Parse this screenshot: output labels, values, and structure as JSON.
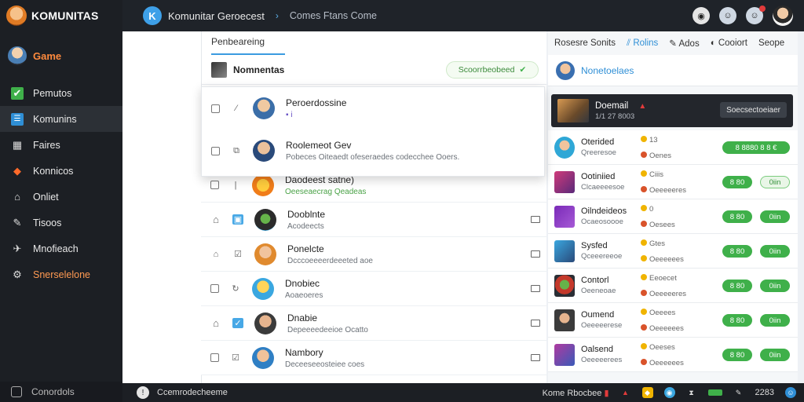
{
  "brand": {
    "name": "KOMUNITAS"
  },
  "sidebar": {
    "game_label": "Game",
    "items": [
      {
        "label": "Pemutos",
        "icon": "check-icon"
      },
      {
        "label": "Komunins",
        "icon": "list-icon"
      },
      {
        "label": "Faires",
        "icon": "grid-icon"
      },
      {
        "label": "Konnicos",
        "icon": "gem-icon"
      },
      {
        "label": "Onliet",
        "icon": "home-icon"
      },
      {
        "label": "Tisoos",
        "icon": "wrench-icon"
      },
      {
        "label": "Mnofieach",
        "icon": "pin-icon"
      },
      {
        "label": "Snerselelone",
        "icon": "gear-icon"
      }
    ],
    "footer": "Conordols"
  },
  "topbar": {
    "title": "Komunitar Geroecest",
    "crumbs": "Comes  Ftans  Come"
  },
  "main": {
    "tab": "Penbeareing",
    "subheader": "Nomnentas",
    "search_pill": "Scoorrbeobeed"
  },
  "dropdown": [
    {
      "title": "Peroerdossine",
      "sub": "▪ i"
    },
    {
      "title": "Roolemeot Gev",
      "sub": "Pobeces Oiteaedt ofeseraedes codecchee Ooers."
    }
  ],
  "list": [
    {
      "title": "Daodeest satne)",
      "sub": "Oeeseaecrag Qeadeas"
    },
    {
      "title": "Dooblnte",
      "sub": "Acodeects"
    },
    {
      "title": "Ponelcte",
      "sub": "Dcccoeeeerdeeeted aoe"
    },
    {
      "title": "Dnobiec",
      "sub": "Aoaeoeres"
    },
    {
      "title": "Dnabie",
      "sub": "Depeeeedeeioe Ocatto"
    },
    {
      "title": "Nambory",
      "sub": "Deceeseeosteiee coes"
    }
  ],
  "right": {
    "head": [
      "Rosesre Sonits",
      "Rolins",
      "Ados",
      "Cooiort",
      "Seope"
    ],
    "title": "Nonetoelaes",
    "featured": {
      "title": "Doemail",
      "sub": "1/1 27  8003",
      "button": "Soecsectoeiaer"
    },
    "rows": [
      {
        "title": "Oterided",
        "sub": "Qreeresoe",
        "stat1": "13",
        "stat2": "Oenes",
        "pill1": "8 8880 8 8 €",
        "pill2": ""
      },
      {
        "title": "Ootiniied",
        "sub": "Clcaeeeesoe",
        "stat1": "Ciiis",
        "stat2": "Oeeeeeres",
        "pill1": "8 80",
        "pill2": "0iin"
      },
      {
        "title": "Oilndeideos",
        "sub": "Ocaeosoooe",
        "stat1": "0",
        "stat2": "Oesees",
        "pill1": "8 80",
        "pill2": "0iin"
      },
      {
        "title": "Sysfed",
        "sub": "Qceeereeoe",
        "stat1": "Gtes",
        "stat2": "Oeeeeees",
        "pill1": "8 80",
        "pill2": "0iin"
      },
      {
        "title": "Contorl",
        "sub": "Oeeneoae",
        "stat1": "Eeoecet",
        "stat2": "Oeeeeeres",
        "pill1": "8 80",
        "pill2": "0iin"
      },
      {
        "title": "Oumend",
        "sub": "Oeeeeerese",
        "stat1": "Oeeees",
        "stat2": "Oeeeeees",
        "pill1": "8 80",
        "pill2": "0iin"
      },
      {
        "title": "Oalsend",
        "sub": "Oeeeeerees",
        "stat1": "Oeeses",
        "stat2": "Oeeeeees",
        "pill1": "8 80",
        "pill2": "0iin"
      }
    ]
  },
  "bottombar": {
    "left": "Ccemrodecheeme",
    "right_label": "Kome Rbocbee",
    "count": "2283"
  }
}
